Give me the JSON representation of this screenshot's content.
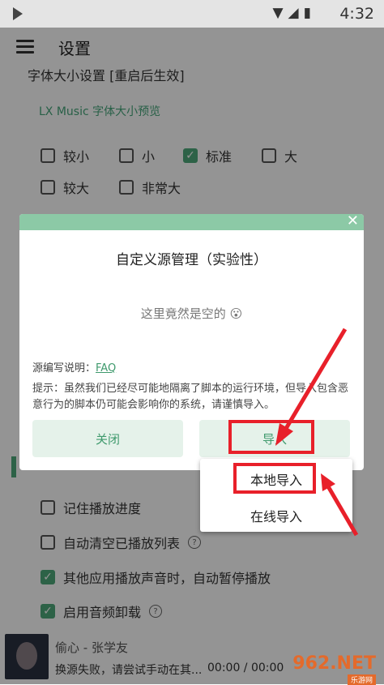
{
  "status_bar": {
    "time": "4:32"
  },
  "app_bar": {
    "title": "设置"
  },
  "font_size_section": {
    "title": "字体大小设置 [重启后生效]",
    "preview": "LX Music 字体大小预览",
    "options": [
      {
        "label": "较小",
        "checked": false
      },
      {
        "label": "小",
        "checked": false
      },
      {
        "label": "标准",
        "checked": true
      },
      {
        "label": "大",
        "checked": false
      },
      {
        "label": "较大",
        "checked": false
      },
      {
        "label": "非常大",
        "checked": false
      }
    ]
  },
  "dialog": {
    "title": "自定义源管理（实验性）",
    "empty_text": "这里竟然是空的 😮",
    "faq_label": "源编写说明：",
    "faq_link": "FAQ",
    "tip": "提示：虽然我们已经尽可能地隔离了脚本的运行环境，但导入包含恶意行为的脚本仍可能会影响你的系统，请谨慎导入。",
    "close_button": "关闭",
    "import_button": "导入"
  },
  "import_menu": {
    "items": [
      "本地导入",
      "在线导入"
    ]
  },
  "play_settings": {
    "options": [
      {
        "label": "记住播放进度",
        "checked": false,
        "help": false
      },
      {
        "label": "自动清空已播放列表",
        "checked": false,
        "help": true
      },
      {
        "label": "其他应用播放声音时，自动暂停播放",
        "checked": true,
        "help": false
      },
      {
        "label": "启用音频卸载",
        "checked": true,
        "help": true
      }
    ]
  },
  "player": {
    "song": "偷心 - 张学友",
    "status": "换源失败，请尝试手动在其...",
    "time": "00:00 / 00:00"
  },
  "watermark": {
    "text": "962.NET",
    "sub": "乐游网"
  },
  "colors": {
    "accent": "#4faa7b",
    "highlight": "#e8202a"
  }
}
